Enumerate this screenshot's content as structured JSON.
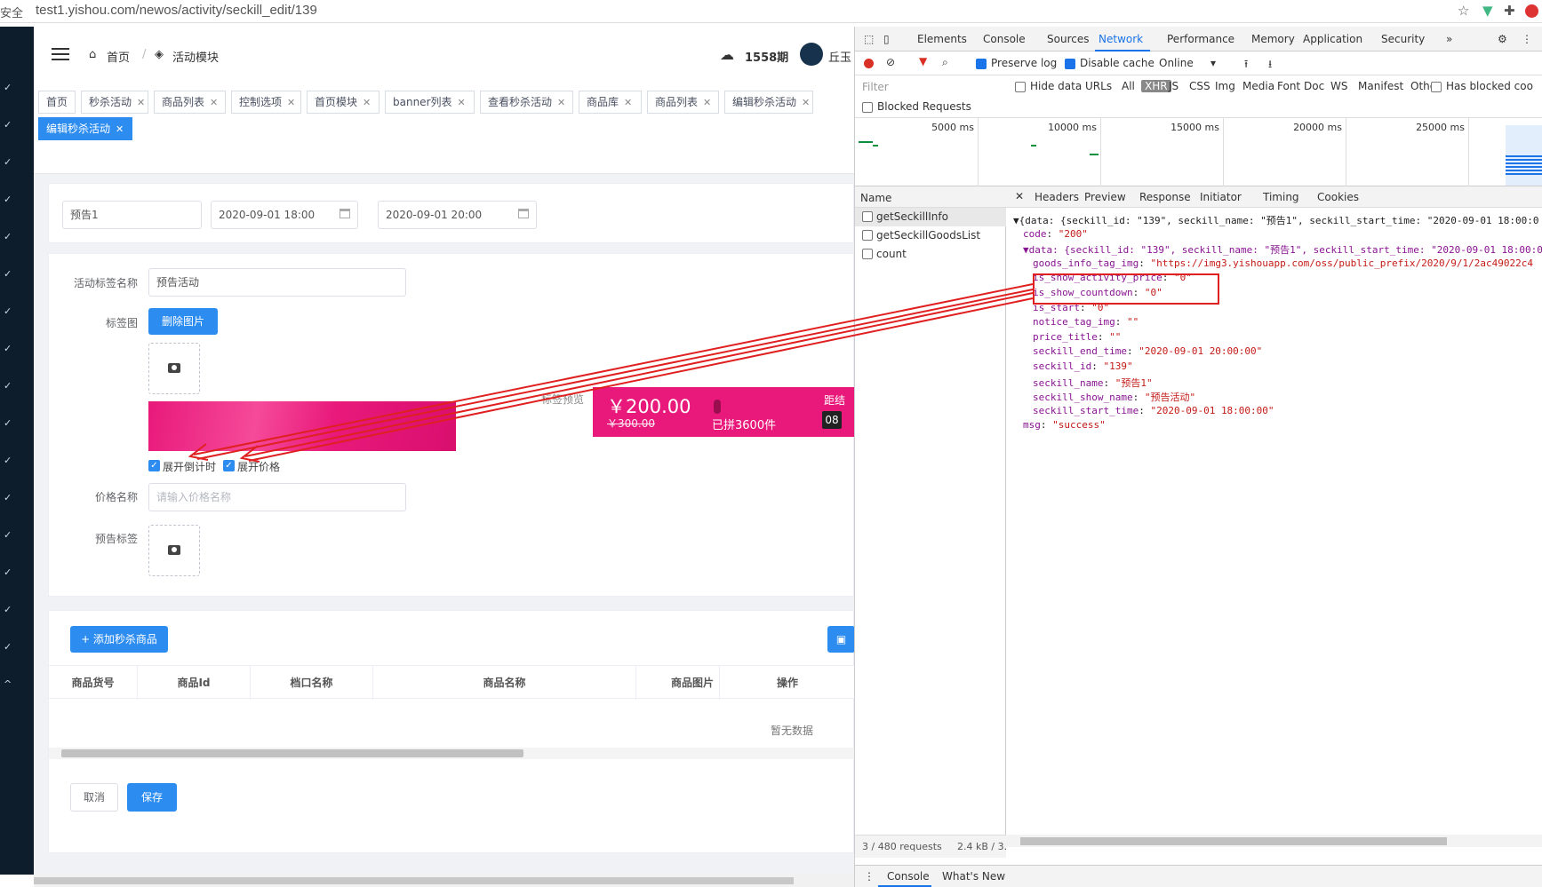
{
  "browser": {
    "insecure_label": "安全",
    "url": "test1.yishou.com/newos/activity/seckill_edit/139"
  },
  "topnav": {
    "breadcrumb_home": "首页",
    "breadcrumb_sep": "/",
    "breadcrumb_module": "活动模块",
    "period": "1558期",
    "user": "丘玉"
  },
  "tags": [
    {
      "label": "首页",
      "closable": false
    },
    {
      "label": "秒杀活动",
      "closable": true
    },
    {
      "label": "商品列表",
      "closable": true
    },
    {
      "label": "控制选项",
      "closable": true
    },
    {
      "label": "首页模块",
      "closable": true
    },
    {
      "label": "banner列表",
      "closable": true
    },
    {
      "label": "查看秒杀活动",
      "closable": true
    },
    {
      "label": "商品库",
      "closable": true
    },
    {
      "label": "商品列表",
      "closable": true
    },
    {
      "label": "编辑秒杀活动",
      "closable": true
    },
    {
      "label": "编辑秒杀活动",
      "closable": true,
      "active": true
    }
  ],
  "form": {
    "name_value": "预告1",
    "start_time": "2020-09-01 18:00",
    "end_time": "2020-09-01 20:00",
    "tag_name_label": "活动标签名称",
    "tag_name_value": "预告活动",
    "tag_img_label": "标签图",
    "delete_img_btn": "删除图片",
    "preview_label": "标签预览",
    "preview_price": "￥200.00",
    "preview_old_price": "￥300.00",
    "preview_sold": "已拼3600件",
    "preview_countdown_label": "距结",
    "preview_countdown_num": "08",
    "show_countdown_label": "展开倒计时",
    "show_price_label": "展开价格",
    "price_name_label": "价格名称",
    "price_name_placeholder": "请输入价格名称",
    "notice_tag_label": "预告标签"
  },
  "goods": {
    "add_btn": "+ 添加秒杀商品",
    "columns": [
      "商品货号",
      "商品Id",
      "档口名称",
      "商品名称",
      "商品图片",
      "操作"
    ],
    "empty_text": "暂无数据",
    "cancel_btn": "取消",
    "save_btn": "保存"
  },
  "devtools": {
    "tabs": [
      "Elements",
      "Console",
      "Sources",
      "Network",
      "Performance",
      "Memory",
      "Application",
      "Security"
    ],
    "selected_tab": "Network",
    "preserve_log": "Preserve log",
    "disable_cache": "Disable cache",
    "throttle": "Online",
    "filter_placeholder": "Filter",
    "hide_data_urls": "Hide data URLs",
    "filter_types": [
      "All",
      "XHR",
      "JS",
      "CSS",
      "Img",
      "Media",
      "Font",
      "Doc",
      "WS",
      "Manifest",
      "Other"
    ],
    "has_blocked": "Has blocked coo",
    "blocked_requests": "Blocked Requests",
    "timeline_ticks": [
      "5000 ms",
      "10000 ms",
      "15000 ms",
      "20000 ms",
      "25000 ms"
    ],
    "name_header": "Name",
    "requests": [
      "getSeckillInfo",
      "getSeckillGoodsList",
      "count"
    ],
    "detail_tabs": [
      "Headers",
      "Preview",
      "Response",
      "Initiator",
      "Timing",
      "Cookies"
    ],
    "selected_detail_tab": "Preview",
    "status_requests": "3 / 480 requests",
    "status_size": "2.4 kB / 3.",
    "drawer_tabs": [
      "Console",
      "What's New"
    ],
    "preview_lines": [
      {
        "text": "▼{data: {seckill_id: \"139\", seckill_name: \"预告1\", seckill_start_time: \"2020-09-01 18:00:0",
        "indent": 0,
        "style": "plain"
      },
      {
        "key": "code",
        "val": "\"200\"",
        "indent": 1
      },
      {
        "text": "▼data: {seckill_id: \"139\", seckill_name: \"预告1\", seckill_start_time: \"2020-09-01 18:00:0",
        "indent": 1,
        "style": "key"
      },
      {
        "key": "goods_info_tag_img",
        "val": "\"https://img3.yishouapp.com/oss/public_prefix/2020/9/1/2ac49022c4",
        "indent": 2
      },
      {
        "key": "is_show_activity_price",
        "val": "\"0\"",
        "indent": 2
      },
      {
        "key": "is_show_countdown",
        "val": "\"0\"",
        "indent": 2
      },
      {
        "key": "is_start",
        "val": "\"0\"",
        "indent": 2
      },
      {
        "key": "notice_tag_img",
        "val": "\"\"",
        "indent": 2
      },
      {
        "key": "price_title",
        "val": "\"\"",
        "indent": 2
      },
      {
        "key": "seckill_end_time",
        "val": "\"2020-09-01 20:00:00\"",
        "indent": 2
      },
      {
        "key": "seckill_id",
        "val": "\"139\"",
        "indent": 2
      },
      {
        "key": "seckill_name",
        "val": "\"预告1\"",
        "indent": 2
      },
      {
        "key": "seckill_show_name",
        "val": "\"预告活动\"",
        "indent": 2
      },
      {
        "key": "seckill_start_time",
        "val": "\"2020-09-01 18:00:00\"",
        "indent": 2
      },
      {
        "key": "msg",
        "val": "\"success\"",
        "indent": 1
      }
    ]
  },
  "colors": {
    "primary": "#2d8cf0",
    "banner": "#e8197a",
    "annotation": "#e02020",
    "sidebar": "#0e1d2c"
  }
}
